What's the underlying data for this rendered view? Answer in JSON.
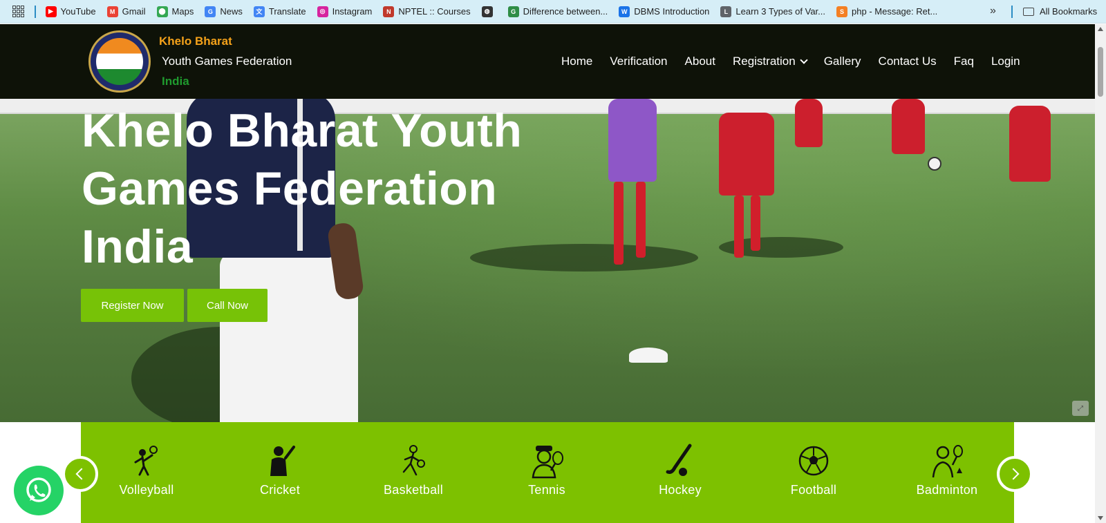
{
  "bookmarks_bar": {
    "items": [
      {
        "label": "YouTube",
        "icon": "youtube-icon",
        "color": "#ff0000",
        "glyph": "▶"
      },
      {
        "label": "Gmail",
        "icon": "gmail-icon",
        "color": "#ea4335",
        "glyph": "M"
      },
      {
        "label": "Maps",
        "icon": "maps-icon",
        "color": "#34a853",
        "glyph": "⬤"
      },
      {
        "label": "News",
        "icon": "news-icon",
        "color": "#4285f4",
        "glyph": "G"
      },
      {
        "label": "Translate",
        "icon": "translate-icon",
        "color": "#4285f4",
        "glyph": "文"
      },
      {
        "label": "Instagram",
        "icon": "instagram-icon",
        "color": "#d6249f",
        "glyph": "◎"
      },
      {
        "label": "NPTEL :: Courses",
        "icon": "nptel-icon",
        "color": "#c0392b",
        "glyph": "N"
      },
      {
        "label": "",
        "icon": "globe-icon",
        "color": "#333333",
        "glyph": "◍"
      },
      {
        "label": "Difference between...",
        "icon": "gfg-icon",
        "color": "#2f8d46",
        "glyph": "G"
      },
      {
        "label": "DBMS Introduction",
        "icon": "w3-icon",
        "color": "#1a73e8",
        "glyph": "W"
      },
      {
        "label": "Learn 3 Types of Var...",
        "icon": "learn-icon",
        "color": "#5f6368",
        "glyph": "L"
      },
      {
        "label": "php - Message: Ret...",
        "icon": "stackoverflow-icon",
        "color": "#f48024",
        "glyph": "S"
      }
    ],
    "all_bookmarks": "All Bookmarks"
  },
  "header": {
    "brand_line1": "Khelo Bharat",
    "brand_line2": "Youth Games Federation",
    "brand_line3": "India",
    "nav": [
      "Home",
      "Verification",
      "About",
      "Registration",
      "Gallery",
      "Contact Us",
      "Faq",
      "Login"
    ]
  },
  "hero": {
    "title": "Khelo Bharat Youth Games Federation India",
    "register_button": "Register Now",
    "call_button": "Call Now"
  },
  "sports": [
    {
      "label": "Volleyball",
      "icon": "volleyball-player-icon"
    },
    {
      "label": "Cricket",
      "icon": "cricket-player-icon"
    },
    {
      "label": "Basketball",
      "icon": "basketball-player-icon"
    },
    {
      "label": "Tennis",
      "icon": "tennis-player-icon"
    },
    {
      "label": "Hockey",
      "icon": "hockey-stick-icon"
    },
    {
      "label": "Football",
      "icon": "football-icon"
    },
    {
      "label": "Badminton",
      "icon": "badminton-player-icon"
    }
  ],
  "colors": {
    "header_bg": "#0e1208",
    "brand_orange": "#f5a21a",
    "brand_green": "#1f9a2e",
    "accent_green": "#7dc100",
    "whatsapp_green": "#25d366"
  }
}
